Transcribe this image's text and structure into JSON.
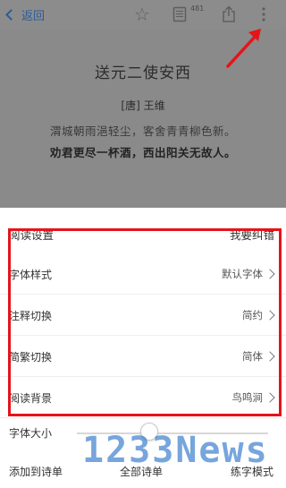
{
  "header": {
    "back_label": "返回",
    "notes_count": "481"
  },
  "poem": {
    "title": "送元二使安西",
    "author": "[唐] 王维",
    "lines": [
      "渭城朝雨浥轻尘，客舍青青柳色新。",
      "劝君更尽一杯酒，西出阳关无故人。"
    ]
  },
  "sheet": {
    "title": "阅读设置",
    "feedback_label": "我要纠错",
    "settings": [
      {
        "label": "字体样式",
        "value": "默认字体"
      },
      {
        "label": "注释切换",
        "value": "简约"
      },
      {
        "label": "简繁切换",
        "value": "简体"
      },
      {
        "label": "阅读背景",
        "value": "鸟鸣涧"
      }
    ],
    "font_size_label": "字体大小",
    "font_size_level": 0.38,
    "actions": [
      "添加到诗单",
      "全部诗单",
      "练字模式"
    ]
  },
  "annotation": {
    "highlight_color": "#e5141a"
  },
  "watermark": "1233News"
}
